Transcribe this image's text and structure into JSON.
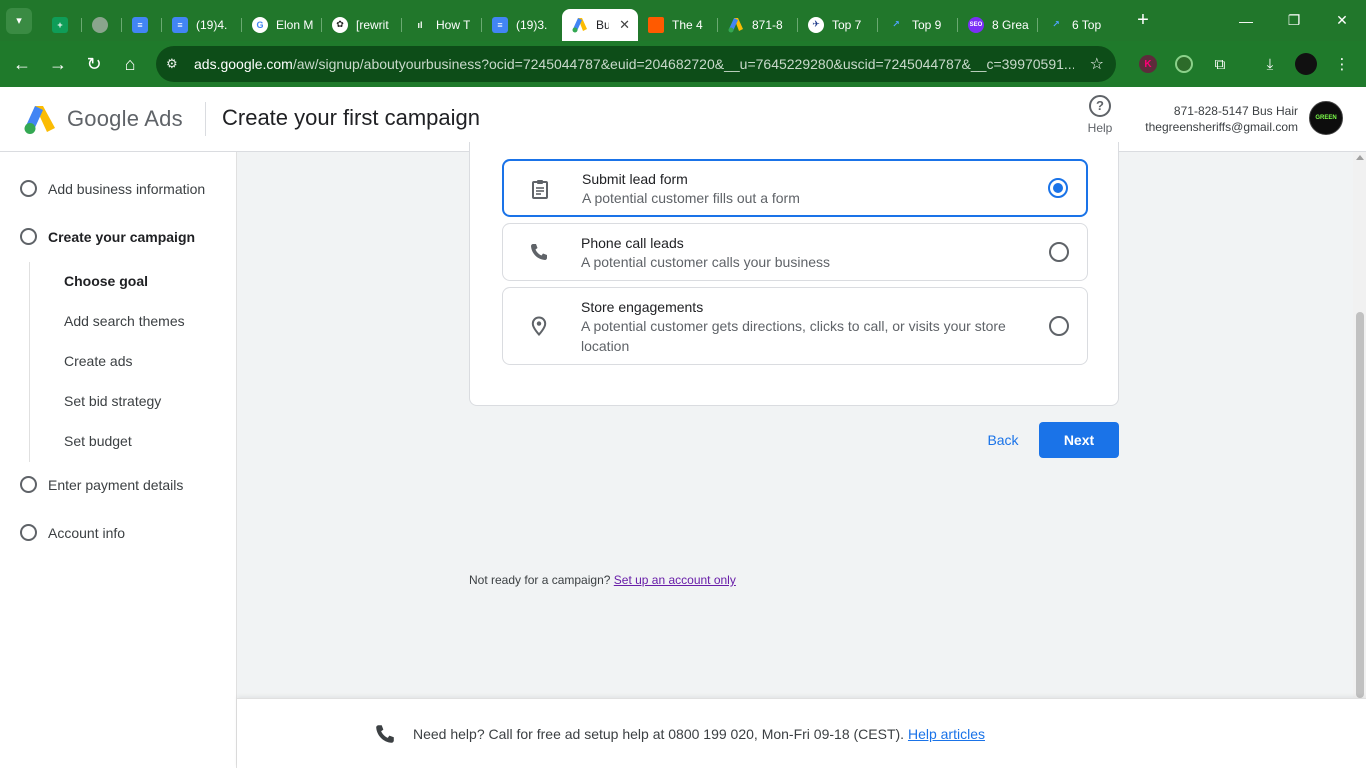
{
  "browser": {
    "tabs": [
      {
        "title": "",
        "icon": "sheets-icon",
        "color": "#0f9d58"
      },
      {
        "title": "",
        "icon": "globe-icon",
        "color": "#8aa58d"
      },
      {
        "title": "",
        "icon": "docs-icon",
        "color": "#4285f4"
      },
      {
        "title": "(19)4.",
        "icon": "docs-icon",
        "color": "#4285f4"
      },
      {
        "title": "Elon M",
        "icon": "google-icon",
        "color": "#ffffff"
      },
      {
        "title": "[rewrit",
        "icon": "openai-icon",
        "color": "#ffffff"
      },
      {
        "title": "How T",
        "icon": "bars-icon",
        "color": "#ffffff"
      },
      {
        "title": "(19)3.",
        "icon": "docs-icon",
        "color": "#4285f4"
      },
      {
        "title": "Bu",
        "icon": "google-ads-icon",
        "color": "#fbbc04",
        "active": true
      },
      {
        "title": "The 4",
        "icon": "orange-square-icon",
        "color": "#ff5a00"
      },
      {
        "title": "871-8",
        "icon": "google-ads-icon",
        "color": "#fbbc04"
      },
      {
        "title": "Top 7",
        "icon": "pilot-icon",
        "color": "#ffffff"
      },
      {
        "title": "Top 9",
        "icon": "trend-icon",
        "color": "#4fa3ff"
      },
      {
        "title": "8 Grea",
        "icon": "seo-icon",
        "color": "#7b2ff7"
      },
      {
        "title": "6 Top",
        "icon": "trend-icon",
        "color": "#4fa3ff"
      }
    ],
    "url_host": "ads.google.com",
    "url_path": "/aw/signup/aboutyourbusiness?ocid=7245044787&euid=204682720&__u=7645229280&uscid=7245044787&__c=39970591..."
  },
  "header": {
    "brand_google": "Google",
    "brand_ads": "Ads",
    "title": "Create your first campaign",
    "help_label": "Help",
    "account_name": "871-828-5147 Bus Hair",
    "account_email": "thegreensheriffs@gmail.com"
  },
  "sidebar": {
    "steps": {
      "business": "Add business information",
      "campaign": "Create your campaign",
      "payment": "Enter payment details",
      "account": "Account info"
    },
    "substeps": {
      "goal": "Choose goal",
      "themes": "Add search themes",
      "ads": "Create ads",
      "bid": "Set bid strategy",
      "budget": "Set budget"
    }
  },
  "options": [
    {
      "title": "Submit lead form",
      "desc": "A potential customer fills out a form",
      "selected": true
    },
    {
      "title": "Phone call leads",
      "desc": "A potential customer calls your business",
      "selected": false
    },
    {
      "title": "Store engagements",
      "desc": "A potential customer gets directions, clicks to call, or visits your store location",
      "selected": false
    }
  ],
  "actions": {
    "back": "Back",
    "next": "Next"
  },
  "not_ready": {
    "text": "Not ready for a campaign?",
    "link": "Set up an account only"
  },
  "footer": {
    "text": "Need help? Call for free ad setup help at 0800 199 020, Mon-Fri 09-18 (CEST).",
    "link": "Help articles"
  },
  "colors": {
    "accent": "#1a73e8",
    "chrome": "#21772b"
  }
}
